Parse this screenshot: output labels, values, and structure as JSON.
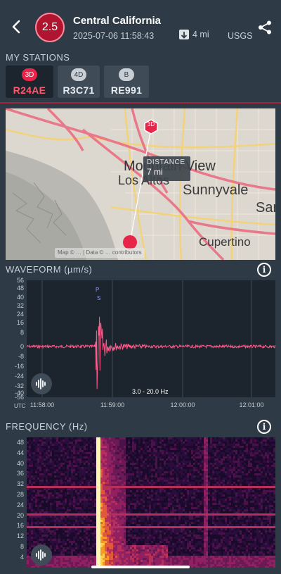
{
  "header": {
    "magnitude": "2.5",
    "title": "Central California",
    "datetime": "2025-07-06 11:58:43",
    "distance": "4 mi",
    "source": "USGS",
    "back_icon": "chevron-left-icon",
    "share_icon": "share-icon"
  },
  "stations": {
    "label": "MY STATIONS",
    "items": [
      {
        "type": "3D",
        "name": "R24AE",
        "active": true
      },
      {
        "type": "4D",
        "name": "R3C71",
        "active": false
      },
      {
        "type": "B",
        "name": "RE991",
        "active": false
      }
    ]
  },
  "map": {
    "station_marker": "3D",
    "distance_label": "DISTANCE",
    "distance_value": "7 mi",
    "places": [
      "Mountain View",
      "Los Altos",
      "Sunnyvale",
      "Cupertino",
      "San"
    ],
    "attribution": "Map © … | Data © … contributors"
  },
  "waveform": {
    "label": "WAVEFORM (µm/s)",
    "y_ticks": [
      "56",
      "48",
      "40",
      "32",
      "24",
      "16",
      "8",
      "0",
      "-8",
      "-16",
      "-24",
      "-32",
      "-40",
      "-56"
    ],
    "x_ticks": [
      "11:58:00",
      "11:59:00",
      "12:00:00",
      "12:01:00"
    ],
    "x_unit": "UTC",
    "filter": "3.0 - 20.0 Hz",
    "phase_p": "P",
    "phase_s": "S",
    "trace_color": "#ff5a8a"
  },
  "frequency": {
    "label": "FREQUENCY (Hz)",
    "y_ticks": [
      "48",
      "44",
      "40",
      "36",
      "32",
      "28",
      "24",
      "20",
      "16",
      "12",
      "8",
      "4"
    ]
  },
  "colors": {
    "background": "#2e3a45",
    "accent": "#e8244a",
    "panel": "#1c252d"
  }
}
